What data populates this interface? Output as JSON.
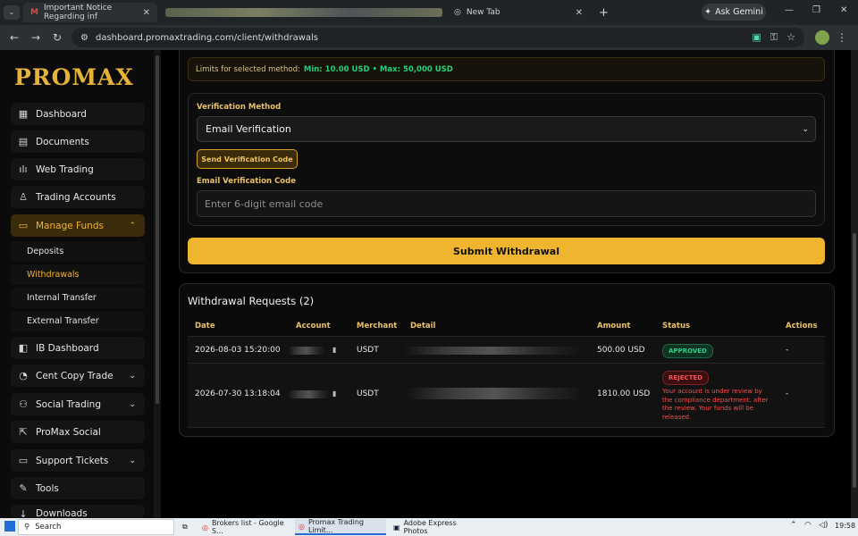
{
  "browser": {
    "tabs": [
      {
        "title": "Important Notice Regarding inf",
        "icon": "gmail-icon"
      },
      {
        "title": "New Tab",
        "icon": "chrome-icon"
      }
    ],
    "url": "dashboard.promaxtrading.com/client/withdrawals",
    "ask_gemini": "Ask Gemini"
  },
  "sidebar": {
    "logo": "PROMAX",
    "items": [
      {
        "label": "Dashboard",
        "icon": "▦"
      },
      {
        "label": "Documents",
        "icon": "▤"
      },
      {
        "label": "Web Trading",
        "icon": "ılı"
      },
      {
        "label": "Trading Accounts",
        "icon": "♙"
      },
      {
        "label": "Manage Funds",
        "icon": "▭"
      }
    ],
    "subitems": [
      "Deposits",
      "Withdrawals",
      "Internal Transfer",
      "External Transfer"
    ],
    "items2": [
      {
        "label": "IB Dashboard",
        "icon": "◧"
      },
      {
        "label": "Cent Copy Trade",
        "icon": "◔"
      },
      {
        "label": "Social Trading",
        "icon": "⚇"
      },
      {
        "label": "ProMax Social",
        "icon": "⇱"
      },
      {
        "label": "Support Tickets",
        "icon": "▭"
      },
      {
        "label": "Tools",
        "icon": "✎"
      },
      {
        "label": "Downloads",
        "icon": "↓"
      }
    ]
  },
  "form": {
    "limits_label": "Limits for selected method:",
    "limits_value": "Min: 10.00 USD • Max: 50,000 USD",
    "verification_method_label": "Verification Method",
    "verification_method_value": "Email Verification",
    "send_code_button": "Send Verification Code",
    "email_code_label": "Email Verification Code",
    "email_code_placeholder": "Enter 6-digit email code",
    "submit_button": "Submit Withdrawal"
  },
  "requests": {
    "title": "Withdrawal Requests (2)",
    "columns": [
      "Date",
      "Account",
      "Merchant",
      "Detail",
      "Amount",
      "Status",
      "Actions"
    ],
    "rows": [
      {
        "date": "2026-08-03 15:20:00",
        "merchant": "USDT",
        "amount": "500.00 USD",
        "status": "APPROVED",
        "actions": "-"
      },
      {
        "date": "2026-07-30 13:18:04",
        "merchant": "USDT",
        "amount": "1810.00 USD",
        "status": "REJECTED",
        "note": "Your account is under review by the compliance department. after the review. Your funds will be released.",
        "actions": "-"
      }
    ]
  },
  "taskbar": {
    "search": "Search",
    "apps": [
      "Brokers list - Google S...",
      "Promax Trading Limit...",
      "Adobe Express Photos"
    ],
    "time": "19:58"
  },
  "colors": {
    "accent": "#efb52f",
    "approved": "#2ad187",
    "rejected": "#ff4a4a"
  }
}
